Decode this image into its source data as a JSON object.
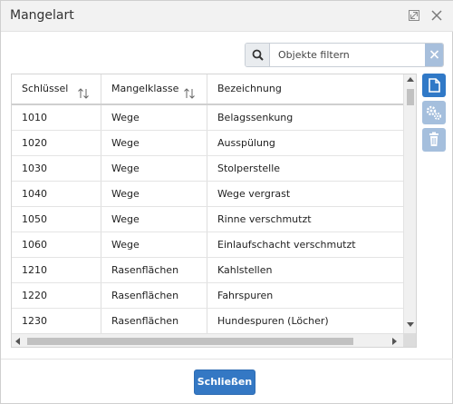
{
  "dialog": {
    "title": "Mangelart",
    "icons": {
      "maximize": "maximize-icon",
      "close": "close-icon"
    }
  },
  "filter": {
    "placeholder": "Objekte filtern",
    "value": "",
    "icons": {
      "search": "search-icon",
      "clear": "close-icon"
    }
  },
  "table": {
    "columns": [
      {
        "label": "Schlüssel",
        "sortable": true
      },
      {
        "label": "Mangelklasse",
        "sortable": true
      },
      {
        "label": "Bezeichnung",
        "sortable": false
      }
    ],
    "rows": [
      [
        "1010",
        "Wege",
        "Belagssenkung"
      ],
      [
        "1020",
        "Wege",
        "Ausspülung"
      ],
      [
        "1030",
        "Wege",
        "Stolperstelle"
      ],
      [
        "1040",
        "Wege",
        "Wege vergrast"
      ],
      [
        "1050",
        "Wege",
        "Rinne verschmutzt"
      ],
      [
        "1060",
        "Wege",
        "Einlaufschacht verschmutzt"
      ],
      [
        "1210",
        "Rasenflächen",
        "Kahlstellen"
      ],
      [
        "1220",
        "Rasenflächen",
        "Fahrspuren"
      ],
      [
        "1230",
        "Rasenflächen",
        "Hundespuren (Löcher)"
      ]
    ]
  },
  "toolbar": {
    "buttons": [
      {
        "name": "new",
        "icon": "document-icon",
        "enabled": true
      },
      {
        "name": "settings",
        "icon": "gears-icon",
        "enabled": false
      },
      {
        "name": "delete",
        "icon": "trash-icon",
        "enabled": false
      }
    ]
  },
  "footer": {
    "close_label": "Schließen"
  },
  "colors": {
    "primary": "#3478c4",
    "disabled": "#a5bfdd",
    "titlebar": "#f2f2f2"
  }
}
